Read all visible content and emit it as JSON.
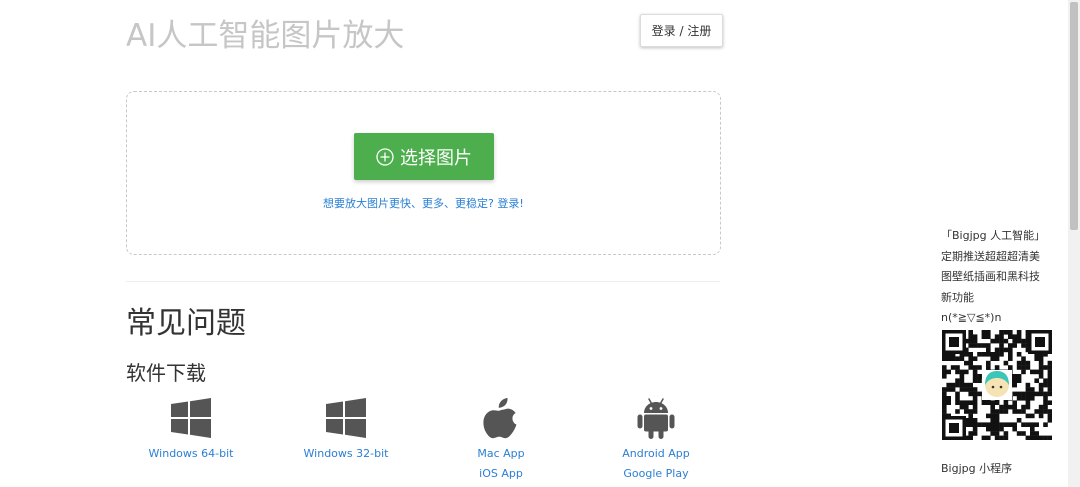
{
  "header": {
    "title": "AI人工智能图片放大",
    "login_label": "登录 / 注册"
  },
  "upload": {
    "button_label": "选择图片",
    "promo_link": "想要放大图片更快、更多、更稳定? 登录!"
  },
  "faq": {
    "heading": "常见问题"
  },
  "downloads": {
    "heading": "软件下载",
    "items": [
      {
        "icon": "windows-icon",
        "links": [
          "Windows 64-bit"
        ]
      },
      {
        "icon": "windows-icon",
        "links": [
          "Windows 32-bit"
        ]
      },
      {
        "icon": "apple-icon",
        "links": [
          "Mac App",
          "iOS App"
        ]
      },
      {
        "icon": "android-icon",
        "links": [
          "Android App",
          "Google Play"
        ]
      }
    ]
  },
  "sidebar": {
    "lines": [
      "「Bigjpg 人工智能」",
      "定期推送超超超清美",
      "图壁纸插画和黑科技",
      "新功能",
      "n(*≧▽≦*)n"
    ],
    "footer": "Bigjpg 小程序"
  },
  "colors": {
    "accent_green": "#4cae4c",
    "link_blue": "#2a7fd4",
    "title_gray": "#c6c6c6"
  }
}
